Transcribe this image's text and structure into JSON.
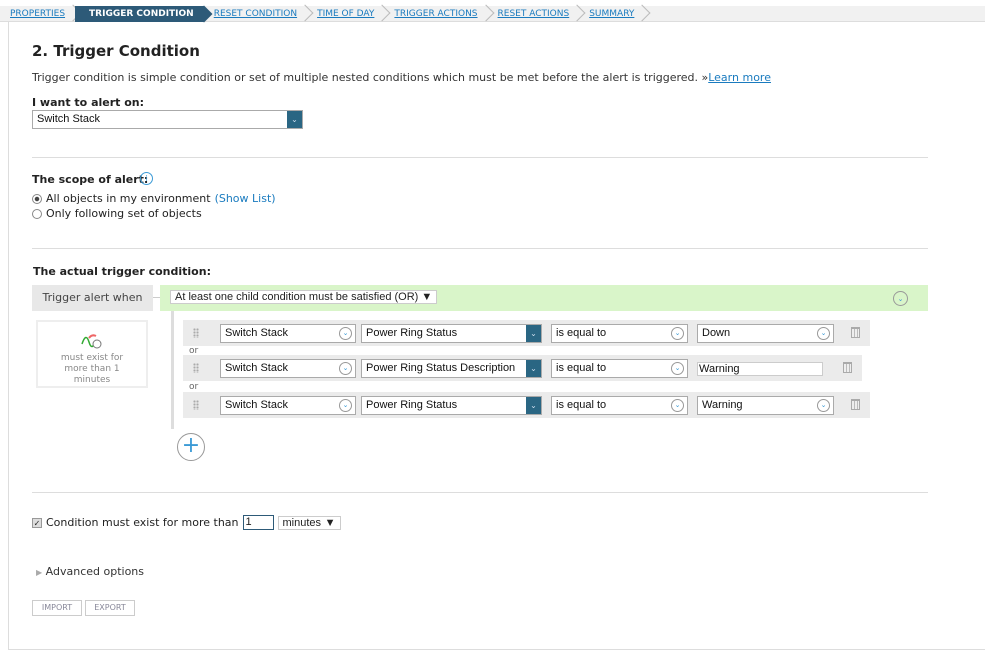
{
  "breadcrumb": [
    "PROPERTIES",
    "TRIGGER CONDITION",
    "RESET CONDITION",
    "TIME OF DAY",
    "TRIGGER ACTIONS",
    "RESET ACTIONS",
    "SUMMARY"
  ],
  "title": "2. Trigger Condition",
  "description": "Trigger condition is simple condition or set of multiple nested conditions which must be met before the alert is triggered. »",
  "learn_more": "Learn more",
  "alert_on": {
    "label": "I want to alert on:",
    "value": "Switch Stack"
  },
  "scope": {
    "label": "The scope of alert:",
    "options": [
      "All objects in my environment",
      "Only following set of objects"
    ],
    "show_list": "(Show List)",
    "selected": 0
  },
  "trigger": {
    "label": "The actual trigger condition:",
    "when": "Trigger alert when",
    "logic": "At least one child condition must be satisfied (OR)",
    "summary": "must exist for more than 1 minutes",
    "or_label": "or",
    "rows": [
      {
        "object": "Switch Stack",
        "property": "Power Ring Status",
        "operator": "is equal to",
        "value": "Down",
        "value_type": "select"
      },
      {
        "object": "Switch Stack",
        "property": "Power Ring Status Description",
        "operator": "is equal to",
        "value": "Warning",
        "value_type": "text"
      },
      {
        "object": "Switch Stack",
        "property": "Power Ring Status",
        "operator": "is equal to",
        "value": "Warning",
        "value_type": "select"
      }
    ]
  },
  "duration": {
    "label": "Condition must exist for more than",
    "checked": true,
    "value": "1",
    "unit": "minutes"
  },
  "advanced": "Advanced options",
  "buttons": {
    "import": "IMPORT",
    "export": "EXPORT"
  },
  "colors": {
    "accent": "#2a6683",
    "green": "#d9f5c9",
    "link": "#1a7bbf"
  }
}
